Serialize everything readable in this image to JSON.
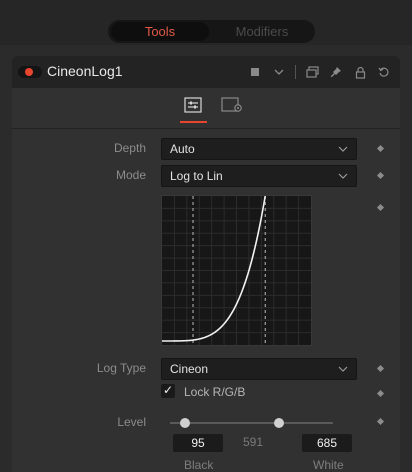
{
  "tabs": [
    {
      "label": "Tools",
      "active": true
    },
    {
      "label": "Modifiers",
      "active": false
    }
  ],
  "node": {
    "name": "CineonLog1",
    "enabled": true,
    "icons": [
      "color-swatch-icon",
      "chevron-down-icon",
      "view-icon",
      "pin-icon",
      "lock-icon",
      "reset-icon"
    ]
  },
  "subtabs": [
    {
      "name": "controls-tab",
      "active": true
    },
    {
      "name": "settings-tab",
      "active": false
    }
  ],
  "controls": {
    "depth": {
      "label": "Depth",
      "value": "Auto"
    },
    "mode": {
      "label": "Mode",
      "value": "Log to Lin"
    },
    "log_type": {
      "label": "Log Type",
      "value": "Cineon"
    },
    "lock_rgb": {
      "label": "Lock R/G/B",
      "checked": true
    },
    "level": {
      "label": "Level",
      "black": "95",
      "mid": "591",
      "white": "685",
      "black_label": "Black",
      "white_label": "White",
      "black_fraction": 0.093,
      "white_fraction": 0.67
    }
  },
  "colors": {
    "accent": "#e8452f",
    "active_tab_text": "#e05a47",
    "panel": "#313131",
    "field_bg": "#1e1e1e"
  }
}
